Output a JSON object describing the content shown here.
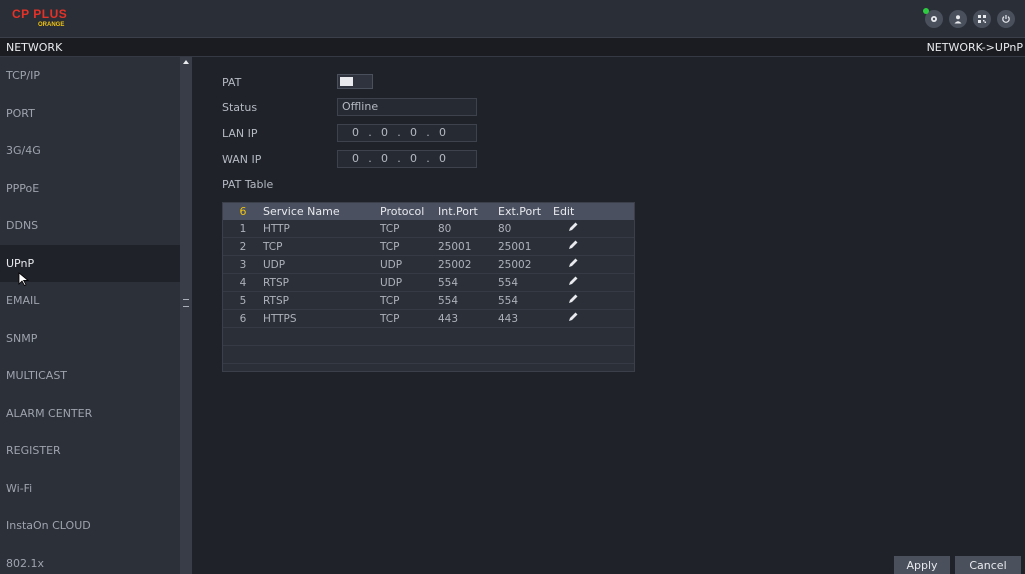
{
  "app": {
    "logo_brand": "CP PLUS",
    "logo_sub": "ORANGE"
  },
  "header": {
    "title": "NETWORK",
    "breadcrumb": "NETWORK->UPnP"
  },
  "sidebar": {
    "items": [
      {
        "label": "TCP/IP"
      },
      {
        "label": "PORT"
      },
      {
        "label": "3G/4G"
      },
      {
        "label": "PPPoE"
      },
      {
        "label": "DDNS"
      },
      {
        "label": "UPnP"
      },
      {
        "label": "EMAIL"
      },
      {
        "label": "SNMP"
      },
      {
        "label": "MULTICAST"
      },
      {
        "label": "ALARM CENTER"
      },
      {
        "label": "REGISTER"
      },
      {
        "label": "Wi-Fi"
      },
      {
        "label": "InstaOn CLOUD"
      },
      {
        "label": "802.1x"
      }
    ],
    "active": "UPnP"
  },
  "form": {
    "pat_label": "PAT",
    "pat_enabled": false,
    "status_label": "Status",
    "status_value": "Offline",
    "lan_ip_label": "LAN IP",
    "lan_ip": [
      "0",
      "0",
      "0",
      "0"
    ],
    "wan_ip_label": "WAN IP",
    "wan_ip": [
      "0",
      "0",
      "0",
      "0"
    ],
    "pat_table_label": "PAT Table"
  },
  "pat_table": {
    "headers": {
      "count": "6",
      "service_name": "Service Name",
      "protocol": "Protocol",
      "int_port": "Int.Port",
      "ext_port": "Ext.Port",
      "edit": "Edit"
    },
    "rows": [
      {
        "num": "1",
        "name": "HTTP",
        "protocol": "TCP",
        "int_port": "80",
        "ext_port": "80"
      },
      {
        "num": "2",
        "name": "TCP",
        "protocol": "TCP",
        "int_port": "25001",
        "ext_port": "25001"
      },
      {
        "num": "3",
        "name": "UDP",
        "protocol": "UDP",
        "int_port": "25002",
        "ext_port": "25002"
      },
      {
        "num": "4",
        "name": "RTSP",
        "protocol": "UDP",
        "int_port": "554",
        "ext_port": "554"
      },
      {
        "num": "5",
        "name": "RTSP",
        "protocol": "TCP",
        "int_port": "554",
        "ext_port": "554"
      },
      {
        "num": "6",
        "name": "HTTPS",
        "protocol": "TCP",
        "int_port": "443",
        "ext_port": "443"
      }
    ]
  },
  "buttons": {
    "apply": "Apply",
    "cancel": "Cancel"
  },
  "icons": {
    "top": [
      "camera-status-icon",
      "user-icon",
      "qr-code-icon",
      "power-icon"
    ]
  },
  "colors": {
    "accent_green": "#2ecc40",
    "logo_red": "#e63127"
  }
}
